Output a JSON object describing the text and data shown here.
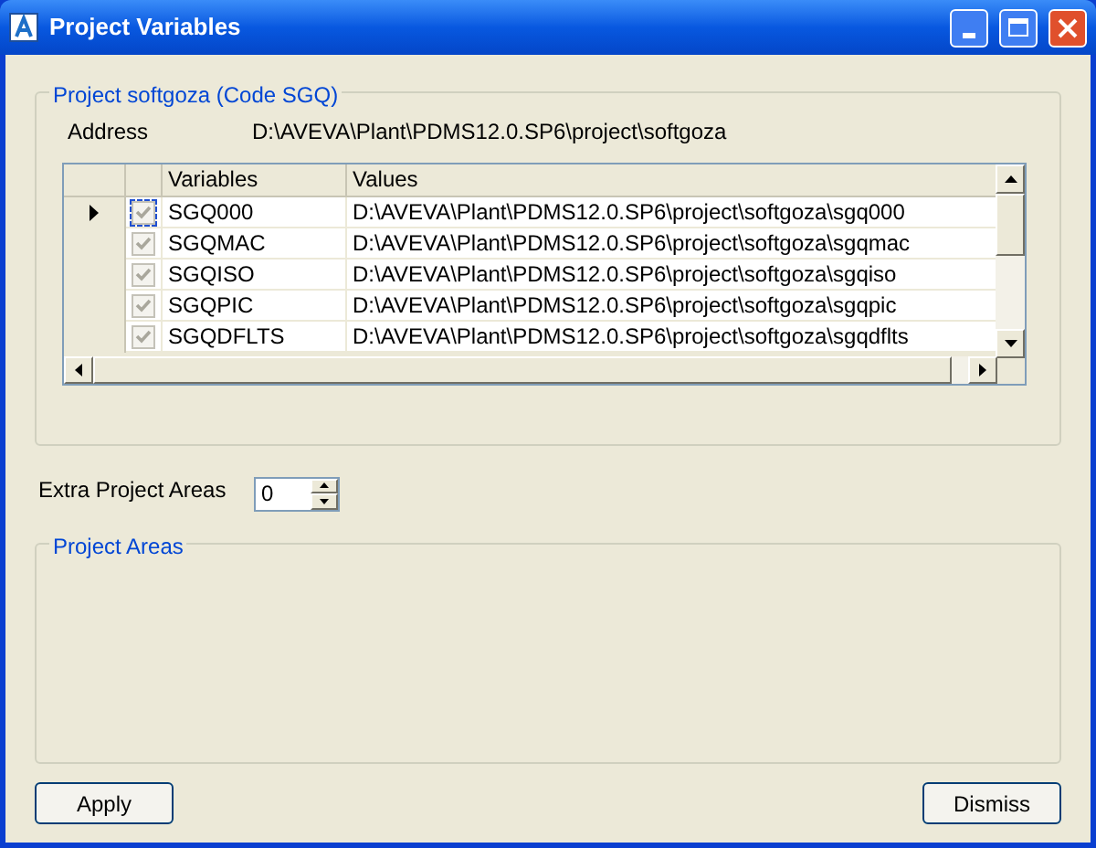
{
  "window": {
    "title": "Project Variables"
  },
  "project_group": {
    "title": "Project softgoza (Code SGQ)",
    "address_label": "Address",
    "address_value": "D:\\AVEVA\\Plant\\PDMS12.0.SP6\\project\\softgoza"
  },
  "grid": {
    "columns": [
      "Variables",
      "Values"
    ],
    "rows": [
      {
        "selected": true,
        "checked": true,
        "variable": "SGQ000",
        "value": "D:\\AVEVA\\Plant\\PDMS12.0.SP6\\project\\softgoza\\sgq000"
      },
      {
        "selected": false,
        "checked": true,
        "variable": "SGQMAC",
        "value": "D:\\AVEVA\\Plant\\PDMS12.0.SP6\\project\\softgoza\\sgqmac"
      },
      {
        "selected": false,
        "checked": true,
        "variable": "SGQISO",
        "value": "D:\\AVEVA\\Plant\\PDMS12.0.SP6\\project\\softgoza\\sgqiso"
      },
      {
        "selected": false,
        "checked": true,
        "variable": "SGQPIC",
        "value": "D:\\AVEVA\\Plant\\PDMS12.0.SP6\\project\\softgoza\\sgqpic"
      },
      {
        "selected": false,
        "checked": true,
        "variable": "SGQDFLTS",
        "value": "D:\\AVEVA\\Plant\\PDMS12.0.SP6\\project\\softgoza\\sgqdflts"
      }
    ]
  },
  "extra_areas": {
    "label": "Extra Project Areas",
    "value": "0"
  },
  "areas_group": {
    "title": "Project Areas"
  },
  "buttons": [
    "Apply",
    "Dismiss"
  ]
}
